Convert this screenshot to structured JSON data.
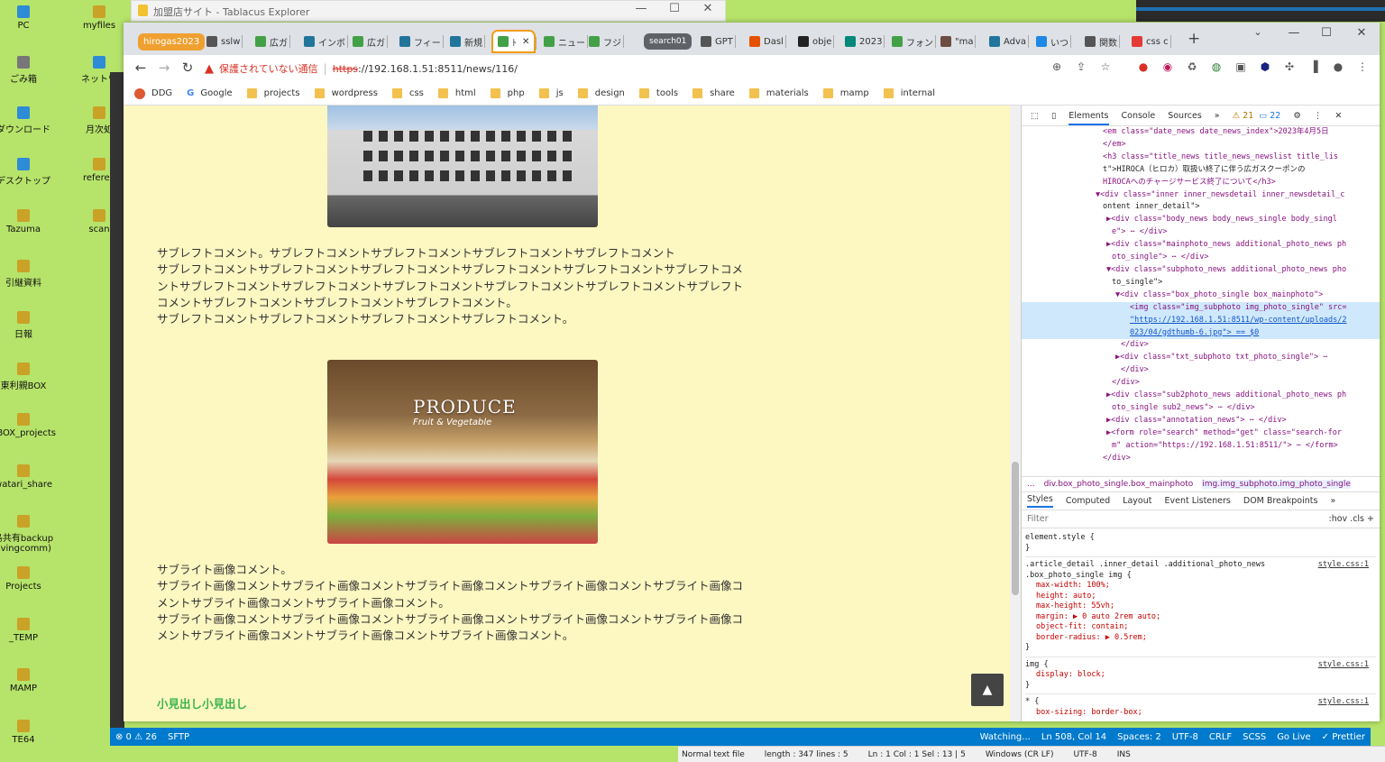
{
  "desktop": {
    "icons_left": [
      "PC",
      "ごみ箱",
      "ダウンロード",
      "デスクトップ",
      "Tazuma",
      "引継資料",
      "日報",
      "東利親BOX",
      "EBOX_projects",
      "watari_share",
      "島共有backup\nlivingcomm)",
      "Projects",
      "_TEMP",
      "MAMP",
      "TE64"
    ],
    "icons_right": [
      "myfiles",
      "ネットワ",
      "月次処",
      "referen",
      "scan"
    ]
  },
  "tablacus": {
    "title": "加盟店サイト - Tablacus Explorer"
  },
  "chrome": {
    "groups": {
      "hirogas": "hirogas2023",
      "search": "search01"
    },
    "tabs": [
      "sslw",
      "広ガ",
      "インボ",
      "広ガ",
      "フィー",
      "新規",
      "ﾄ",
      "ニュー",
      "フジ",
      "GPT",
      "Dasl",
      "obje",
      "2023",
      "フォン",
      "\"ma",
      "Adva",
      "いつ",
      "関数",
      "css c"
    ],
    "address": {
      "warning": "保護されていない通信",
      "scheme": "https",
      "rest": "://192.168.1.51:8511/news/116/"
    },
    "bookmarks": [
      "DDG",
      "Google",
      "projects",
      "wordpress",
      "css",
      "html",
      "php",
      "js",
      "design",
      "tools",
      "share",
      "materials",
      "mamp",
      "internal"
    ]
  },
  "page": {
    "para1": [
      "サブレフトコメント。サブレフトコメントサブレフトコメントサブレフトコメントサブレフトコメント",
      "サブレフトコメントサブレフトコメントサブレフトコメントサブレフトコメントサブレフトコメントサブレフトコメ",
      "ントサブレフトコメントサブレフトコメントサブレフトコメントサブレフトコメントサブレフトコメントサブレフト",
      "コメントサブレフトコメントサブレフトコメントサブレフトコメント。",
      "サブレフトコメントサブレフトコメントサブレフトコメントサブレフトコメント。"
    ],
    "image2_text": "PRODUCE",
    "image2_sub": "Fruit & Vegetable",
    "para2": [
      "サブライト画像コメント。",
      "サブライト画像コメントサブライト画像コメントサブライト画像コメントサブライト画像コメントサブライト画像コ",
      "メントサブライト画像コメントサブライト画像コメント。",
      "サブライト画像コメントサブライト画像コメントサブライト画像コメントサブライト画像コメントサブライト画像コ",
      "メントサブライト画像コメントサブライト画像コメントサブライト画像コメント。"
    ],
    "midashi": "小見出し小見出し",
    "to_top": "▲"
  },
  "devtools": {
    "tabs": [
      "Elements",
      "Console",
      "Sources",
      "»"
    ],
    "warnings": "21",
    "infos": "22",
    "breadcrumbs": [
      "...",
      "div.box_photo_single.box_mainphoto",
      "img.img_subphoto.img_photo_single"
    ],
    "sub_tabs": [
      "Styles",
      "Computed",
      "Layout",
      "Event Listeners",
      "DOM Breakpoints",
      "»"
    ],
    "filter_placeholder": "Filter",
    "filter_tools": ":hov .cls +",
    "dom_lines": [
      "<em class=\"date_news date_news_index\">2023年4月5日",
      "</em>",
      "<h3 class=\"title_news title_news_newslist title_lis",
      "t\">HIROCA（ヒロカ）取扱い終了に伴う広ガスクーポンの",
      "HIROCAへのチャージサービス終了について</h3>",
      "▼<div class=\"inner inner_newsdetail inner_newsdetail_c",
      "ontent inner_detail\">",
      "▶<div class=\"body_news body_news_single body_singl",
      "e\"> ⋯ </div>",
      "▶<div class=\"mainphoto_news additional_photo_news ph",
      "oto_single\"> ⋯ </div>",
      "▼<div class=\"subphoto_news additional_photo_news pho",
      "to_single\">",
      "▼<div class=\"box_photo_single box_mainphoto\">",
      "<img class=\"img_subphoto img_photo_single\" src=",
      "\"https://192.168.1.51:8511/wp-content/uploads/2",
      "023/04/gdthumb-6.jpg\"> == $0",
      "</div>",
      "▶<div class=\"txt_subphoto txt_photo_single\"> ⋯",
      "</div>",
      "</div>",
      "▶<div class=\"sub2photo_news additional_photo_news ph",
      "oto_single sub2_news\"> ⋯ </div>",
      "▶<div class=\"annotation_news\"> ⋯ </div>",
      "▶<form role=\"search\" method=\"get\" class=\"search-for",
      "m\" action=\"https://192.168.1.51:8511/\"> ⋯ </form>",
      "</div>"
    ],
    "styles": {
      "r0_sel": "element.style {",
      "r0_end": "}",
      "r1_sel1": ".article_detail .inner_detail .additional_photo_news",
      "r1_sel2": ".box_photo_single img {",
      "r1_src": "style.css:1",
      "r1_p1": "max-width: 100%;",
      "r1_p2": "height: auto;",
      "r1_p3": "max-height: 55vh;",
      "r1_p4": "margin: ▶ 0 auto 2rem auto;",
      "r1_p5": "object-fit: contain;",
      "r1_p6": "border-radius: ▶ 0.5rem;",
      "r1_end": "}",
      "r2_sel": "img {",
      "r2_src": "style.css:1",
      "r2_p1": "display: block;",
      "r2_end": "}",
      "r3_sel": "* {",
      "r3_src": "style.css:1",
      "r3_p1": "box-sizing: border-box;"
    }
  },
  "vscode_status": {
    "problems": "⊗ 0 ⚠ 26",
    "sftp": "SFTP",
    "watching": "Watching...",
    "position": "Ln 508, Col 14",
    "spaces": "Spaces: 2",
    "encoding": "UTF-8",
    "eol": "CRLF",
    "lang": "SCSS",
    "golive": "Go Live",
    "prettier": "✓ Prettier"
  },
  "notepad_status": [
    "Normal text file",
    "length : 347   lines : 5",
    "Ln : 1   Col : 1   Sel : 13 | 5",
    "Windows (CR LF)",
    "UTF-8",
    "INS"
  ],
  "colors": {
    "page_bg": "#fdf7c2",
    "accent_tab": "#f39c12",
    "vscode_blue": "#007acc",
    "desktop_bg": "#b6e36a",
    "midashi": "#3bb54a"
  }
}
